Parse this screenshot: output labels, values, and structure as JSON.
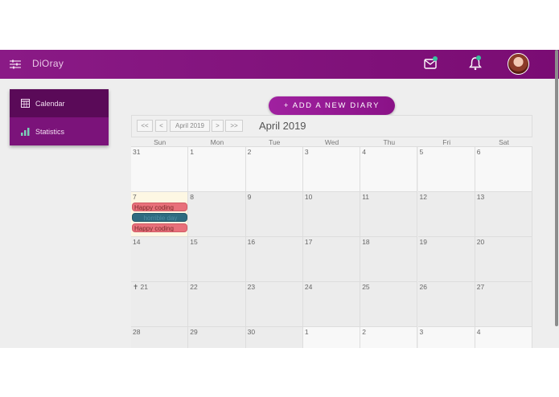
{
  "header": {
    "app_title": "DiOray",
    "menu_icon": "sliders-menu-icon",
    "mail_icon": "mail-icon",
    "bell_icon": "bell-icon",
    "badge_color": "#37c3a0",
    "bar_color": "#7f1179"
  },
  "sidebar": {
    "items": [
      {
        "label": "Calendar",
        "icon": "calendar-grid-icon",
        "active": true
      },
      {
        "label": "Statistics",
        "icon": "bar-chart-icon",
        "active": false
      }
    ]
  },
  "add_button": {
    "label": "+ ADD A NEW DIARY"
  },
  "calendar": {
    "nav": {
      "first": "<<",
      "prev": "<",
      "picker": "April 2019",
      "next": ">",
      "last": ">>"
    },
    "month_title": "April 2019",
    "days_of_week": [
      "Sun",
      "Mon",
      "Tue",
      "Wed",
      "Thu",
      "Fri",
      "Sat"
    ],
    "weeks": [
      [
        "31",
        "1",
        "2",
        "3",
        "4",
        "5",
        "6"
      ],
      [
        "7",
        "8",
        "9",
        "10",
        "11",
        "12",
        "13"
      ],
      [
        "14",
        "15",
        "16",
        "17",
        "18",
        "19",
        "20"
      ],
      [
        "✝ 21",
        "22",
        "23",
        "24",
        "25",
        "26",
        "27"
      ],
      [
        "28",
        "29",
        "30",
        "1",
        "2",
        "3",
        "4"
      ]
    ],
    "events": [
      {
        "label": "Happy coding",
        "color": "#e8707a"
      },
      {
        "label": "horrible day",
        "color": "#2e6b80"
      },
      {
        "label": "Happy coding",
        "color": "#e8707a"
      }
    ]
  }
}
